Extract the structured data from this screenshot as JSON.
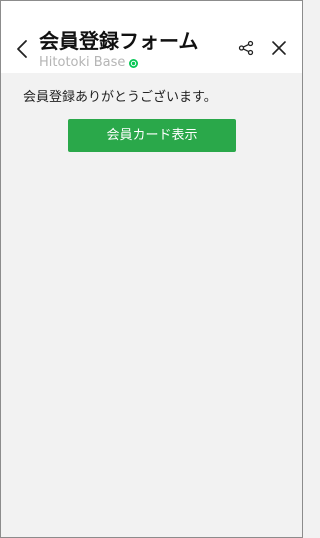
{
  "header": {
    "title": "会員登録フォーム",
    "subtitle": "Hitotoki Base",
    "verified_color": "#06c755",
    "icons": {
      "back": "chevron-left-icon",
      "share": "share-icon",
      "close": "close-icon"
    }
  },
  "main": {
    "message": "会員登録ありがとうございます。",
    "member_card_button_label": "会員カード表示",
    "button_color": "#2aa84a"
  }
}
